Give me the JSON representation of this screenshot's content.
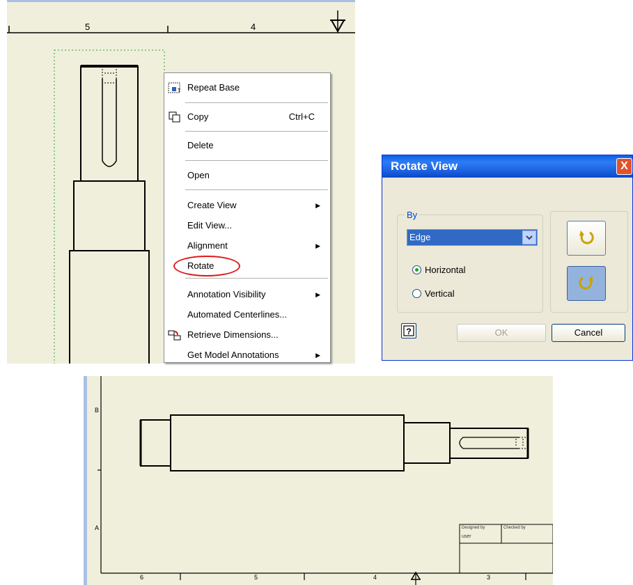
{
  "top_panel": {
    "ruler_labels": [
      "5",
      "4"
    ]
  },
  "context_menu": {
    "items": [
      {
        "label": "Repeat Base",
        "shortcut": "",
        "icon": "repeat-base-icon"
      },
      {
        "label": "Copy",
        "shortcut": "Ctrl+C",
        "icon": "copy-icon"
      },
      {
        "label": "Delete",
        "shortcut": ""
      },
      {
        "label": "Open",
        "shortcut": ""
      },
      {
        "label": "Create View",
        "submenu": true
      },
      {
        "label": "Edit View...",
        "submenu": false
      },
      {
        "label": "Alignment",
        "submenu": true
      },
      {
        "label": "Rotate",
        "submenu": false
      },
      {
        "label": "Annotation Visibility",
        "submenu": true
      },
      {
        "label": "Automated Centerlines...",
        "submenu": false
      },
      {
        "label": "Retrieve Dimensions...",
        "submenu": false,
        "icon": "retrieve-dimensions-icon"
      },
      {
        "label": "Get Model Annotations",
        "submenu": true
      }
    ],
    "highlight_color": "#e01818"
  },
  "dialog": {
    "title": "Rotate View",
    "close_label": "X",
    "group_label": "By",
    "by_value": "Edge",
    "radios": [
      {
        "label": "Horizontal",
        "checked": true
      },
      {
        "label": "Vertical",
        "checked": false
      }
    ],
    "buttons": {
      "help": "?",
      "ok": "OK",
      "cancel": "Cancel"
    },
    "title_color": "#0a5ee8"
  },
  "bottom_panel": {
    "row_labels": [
      "B",
      "A"
    ],
    "ruler_labels": [
      "6",
      "5",
      "4",
      "3"
    ],
    "title_block": {
      "designed_by_label": "Designed by",
      "checked_by_label": "Checked by",
      "designer": "user"
    }
  }
}
